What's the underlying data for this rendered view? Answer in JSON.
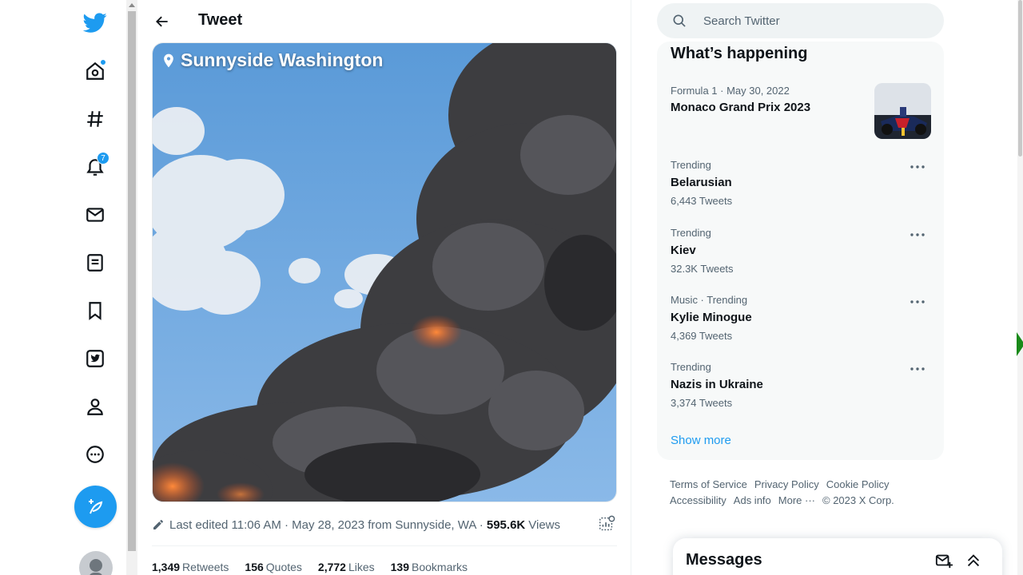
{
  "app": {
    "name": "Twitter",
    "accent_color": "#1d9bf0"
  },
  "nav": {
    "items": [
      {
        "icon": "twitter-logo-icon"
      },
      {
        "icon": "home-icon",
        "has_dot": true
      },
      {
        "icon": "hashtag-icon"
      },
      {
        "icon": "bell-icon",
        "badge": "7"
      },
      {
        "icon": "mail-icon"
      },
      {
        "icon": "lists-icon"
      },
      {
        "icon": "bookmark-icon"
      },
      {
        "icon": "twitter-blue-icon"
      },
      {
        "icon": "profile-icon"
      },
      {
        "icon": "more-circle-icon"
      }
    ],
    "compose_icon": "feather-plus-icon"
  },
  "header": {
    "title": "Tweet"
  },
  "tweet": {
    "media_location_text": "Sunnyside Washington",
    "meta": {
      "edited_text": "Last edited 11:06 AM · May 28, 2023 from Sunnyside, WA ·",
      "views_count": "595.6K",
      "views_label": "Views"
    },
    "stats": [
      {
        "count": "1,349",
        "label": "Retweets"
      },
      {
        "count": "156",
        "label": "Quotes"
      },
      {
        "count": "2,772",
        "label": "Likes"
      },
      {
        "count": "139",
        "label": "Bookmarks"
      }
    ]
  },
  "search": {
    "placeholder": "Search Twitter"
  },
  "trends": {
    "title": "What’s happening",
    "items": [
      {
        "category": "Formula 1 · May 30, 2022",
        "name": "Monaco Grand Prix 2023",
        "count": "",
        "has_image": true
      },
      {
        "category": "Trending",
        "name": "Belarusian",
        "count": "6,443 Tweets"
      },
      {
        "category": "Trending",
        "name": "Kiev",
        "count": "32.3K Tweets"
      },
      {
        "category": "Music · Trending",
        "name": "Kylie Minogue",
        "count": "4,369 Tweets"
      },
      {
        "category": "Trending",
        "name": "Nazis in Ukraine",
        "count": "3,374 Tweets"
      }
    ],
    "show_more": "Show more"
  },
  "footer": {
    "links": [
      "Terms of Service",
      "Privacy Policy",
      "Cookie Policy",
      "Accessibility",
      "Ads info",
      "More ···"
    ],
    "copyright": "© 2023 X Corp."
  },
  "messages": {
    "title": "Messages"
  }
}
